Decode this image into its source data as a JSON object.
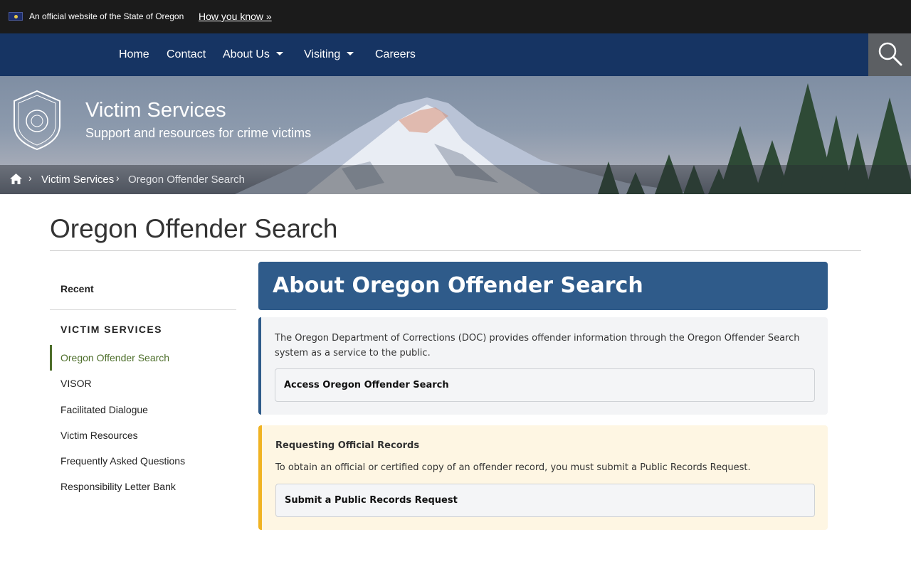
{
  "official_banner": {
    "text": "An official website of the State of Oregon",
    "link": "How you know »",
    "flag_icon": "oregon-flag-icon"
  },
  "nav": {
    "items": [
      {
        "label": "Home",
        "dropdown": false
      },
      {
        "label": "Contact",
        "dropdown": false
      },
      {
        "label": "About Us",
        "dropdown": true
      },
      {
        "label": "Visiting",
        "dropdown": true
      },
      {
        "label": "Careers",
        "dropdown": false
      }
    ],
    "search_icon": "search-icon"
  },
  "hero": {
    "title": "Victim Services",
    "subtitle": "Support and resources for crime victims",
    "seal_icon": "oregon-department-of-corrections-seal"
  },
  "breadcrumb": {
    "home_icon": "home-icon",
    "items": [
      "Victim Services",
      "Oregon Offender Search"
    ]
  },
  "page": {
    "title": "Oregon Offender Search"
  },
  "sidebar": {
    "recent_label": "Recent",
    "section_heading": "VICTIM SERVICES",
    "items": [
      {
        "label": "Oregon Offender Search",
        "active": true
      },
      {
        "label": "VISOR",
        "active": false
      },
      {
        "label": "Facilitated Dialogue",
        "active": false
      },
      {
        "label": "Victim Resources",
        "active": false
      },
      {
        "label": "Frequently Asked Questions",
        "active": false
      },
      {
        "label": "Responsibility Letter Bank",
        "active": false
      }
    ]
  },
  "content": {
    "header": "About Oregon Offender Search",
    "info_text": "The Oregon Department of Corrections (DOC) provides offender information through the Oregon Offender Search system as a service to the public.",
    "access_link": "Access Oregon Offender Search",
    "notice_title": "Requesting Official Records",
    "notice_text": "To obtain an official or certified copy of an offender record, you must submit a Public Records Request.",
    "notice_link": "Submit a Public Records Request"
  },
  "colors": {
    "top_bar": "#1b1b1b",
    "nav_bar": "#163463",
    "header_panel": "#2f5b8a",
    "active_link": "#4d6e2a",
    "notice_accent": "#f0b323",
    "notice_bg": "#fef6e3"
  }
}
